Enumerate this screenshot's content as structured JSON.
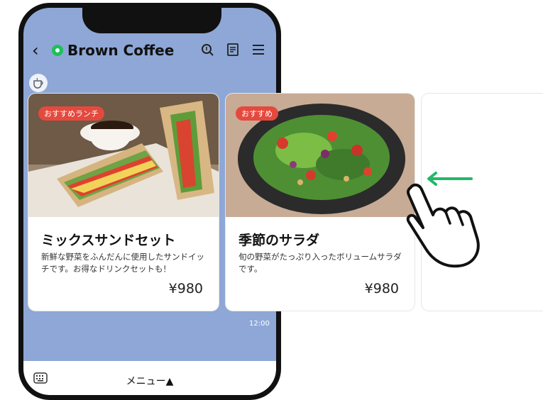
{
  "header": {
    "back_icon": "chevron-left-icon",
    "title": "Brown Coffee",
    "icons": [
      "search-icon",
      "notes-icon",
      "menu-icon"
    ]
  },
  "cards": [
    {
      "badge": "おすすめランチ",
      "title": "ミックスサンドセット",
      "desc": "新鮮な野菜をふんだんに使用したサンドイッチです。お得なドリンクセットも！",
      "price": "¥980"
    },
    {
      "badge": "おすすめ",
      "title": "季節のサラダ",
      "desc": "旬の野菜がたっぷり入ったボリュームサラダです。",
      "price": "¥980"
    }
  ],
  "timestamp": "12:00",
  "footer": {
    "menu_label": "メニュー▲",
    "keyboard_icon": "keyboard-icon"
  },
  "gesture": {
    "hand_icon": "swipe-hand-icon",
    "arrow_icon": "left-arrow-icon",
    "arrow_color": "#22b86a"
  }
}
